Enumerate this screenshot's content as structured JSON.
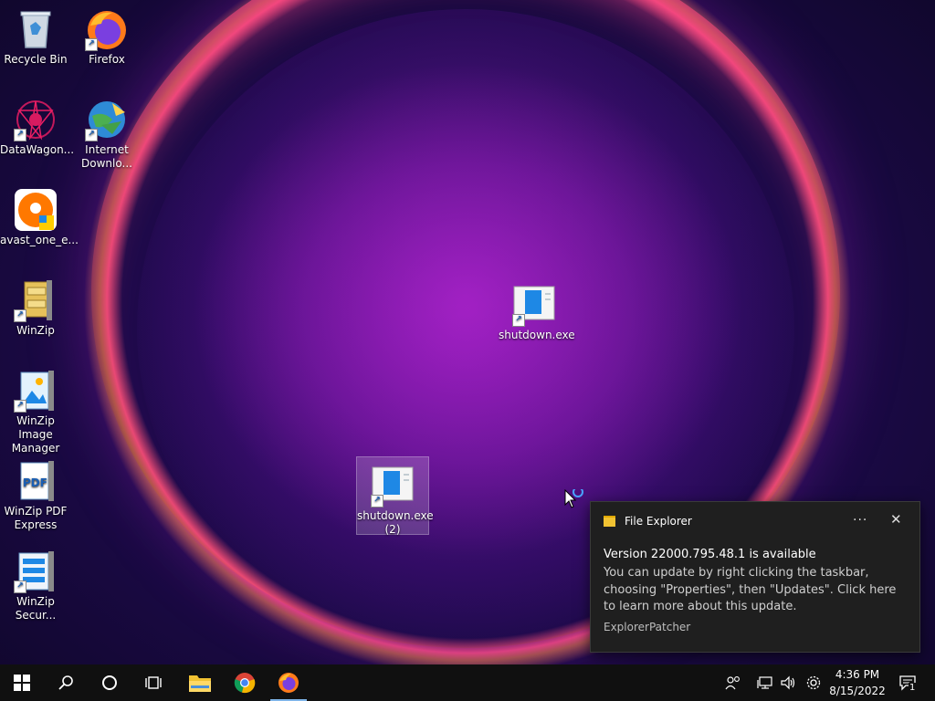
{
  "desktop": {
    "icons": [
      {
        "label": "Recycle Bin"
      },
      {
        "label": "Firefox"
      },
      {
        "label": "DataWagon..."
      },
      {
        "label": "Internet Downlo..."
      },
      {
        "label": "avast_one_e..."
      },
      {
        "label": "WinZip"
      },
      {
        "label": "WinZip Image Manager"
      },
      {
        "label": "WinZip PDF Express"
      },
      {
        "label": "WinZip Secur..."
      },
      {
        "label": "shutdown.exe"
      },
      {
        "label": "shutdown.exe (2)"
      }
    ],
    "pdf_badge": "PDF"
  },
  "notification": {
    "app": "File Explorer",
    "more": "···",
    "close": "✕",
    "title": "Version 22000.795.48.1 is available",
    "body": "You can update by right clicking the taskbar, choosing \"Properties\", then \"Updates\". Click here to learn more about this update.",
    "source": "ExplorerPatcher"
  },
  "taskbar": {
    "time": "4:36 PM",
    "date": "8/15/2022",
    "notification_count": "1"
  },
  "colors": {
    "accent": "#0078d7",
    "taskbar": "#101010",
    "toast": "#1f1f1f"
  }
}
